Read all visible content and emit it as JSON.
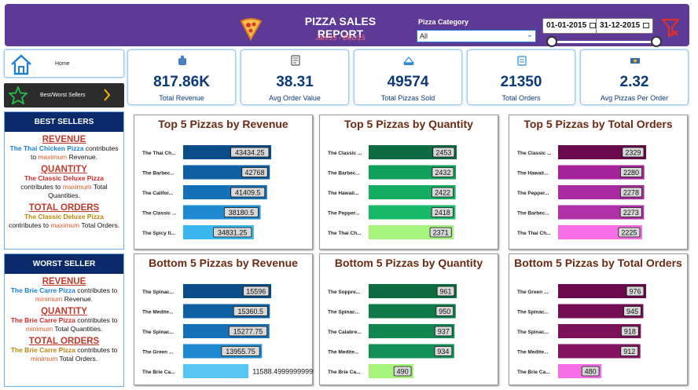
{
  "header": {
    "title": "PIZZA SALES REPORT",
    "subtitle": "Jan/15 - Dec/15",
    "category_label": "Pizza Category",
    "category_value": "All",
    "date_from": "01-01-2015",
    "date_to": "31-12-2015",
    "colors": {
      "bg": "#5d3a96",
      "subtitle": "#ff6b6b"
    }
  },
  "nav": {
    "home_label": "Home",
    "bw_label": "Best/Worst Sellers"
  },
  "best": {
    "heading": "BEST SELLERS",
    "revenue_title": "REVENUE",
    "revenue_pizza": "The Thai Chicken Pizza",
    "revenue_mid": " contributes to ",
    "revenue_kw": "maximum",
    "revenue_end": " Revenue.",
    "quantity_title": "QUANTITY",
    "quantity_pizza": "The Classic Deluxe Pizza",
    "quantity_mid": " contributes to ",
    "quantity_kw": "maximum",
    "quantity_end": " Total Quantities.",
    "orders_title": "TOTAL ORDERS",
    "orders_pizza": "The Classic Deluxe Pizza",
    "orders_mid": " contributes to ",
    "orders_kw": "maximum",
    "orders_end": " Total Orders."
  },
  "worst": {
    "heading": "WORST SELLER",
    "revenue_title": "REVENUE",
    "revenue_pizza": "The Brie Carre Pizza",
    "revenue_mid": " contributes to ",
    "revenue_kw": "minimum",
    "revenue_end": " Revenue.",
    "quantity_title": "QUANTITY",
    "quantity_pizza": "The Brie Carre Pizza",
    "quantity_mid": " contributes to ",
    "quantity_kw": "minimum",
    "quantity_end": " Total Quantities.",
    "orders_title": "TOTAL ORDERS",
    "orders_pizza": "The Brie Carre Pizza",
    "orders_mid": " contributes to ",
    "orders_kw": "minimum",
    "orders_end": " Total Orders."
  },
  "kpis": [
    {
      "value": "817.86K",
      "label": "Total Revenue",
      "icon": "money-bag-icon"
    },
    {
      "value": "38.31",
      "label": "Avg Order Value",
      "icon": "receipt-icon"
    },
    {
      "value": "49574",
      "label": "Total Pizzas Sold",
      "icon": "pizza-box-icon"
    },
    {
      "value": "21350",
      "label": "Total Orders",
      "icon": "clipboard-icon"
    },
    {
      "value": "2.32",
      "label": "Avg Pizzas Per Order",
      "icon": "cash-icon"
    }
  ],
  "chart_data": [
    {
      "type": "bar",
      "title": "Top 5 Pizzas by Revenue",
      "categories": [
        "The Thai Ch...",
        "The Barbec...",
        "The Califor...",
        "The Classic ...",
        "The Spicy It..."
      ],
      "values": [
        43434.25,
        42768,
        41409.5,
        38180.5,
        34831.25
      ],
      "value_labels": [
        "43434.25",
        "42768",
        "41409.5",
        "38180.5",
        "34831.25"
      ],
      "colors": [
        "#0b4d8a",
        "#0f5fa3",
        "#1570b8",
        "#1d8ad2",
        "#3ab6ee"
      ],
      "title_color": "#6b2b12"
    },
    {
      "type": "bar",
      "title": "Top 5 Pizzas by Quantity",
      "categories": [
        "The Classic ...",
        "The Barbec...",
        "The Hawaii...",
        "The Pepper...",
        "The Thai Ch..."
      ],
      "values": [
        2453,
        2432,
        2422,
        2418,
        2371
      ],
      "value_labels": [
        "2453",
        "2432",
        "2422",
        "2418",
        "2371"
      ],
      "colors": [
        "#0c6b3f",
        "#10a05a",
        "#14ad62",
        "#17b868",
        "#a6f57a"
      ],
      "title_color": "#6b2b12"
    },
    {
      "type": "bar",
      "title": "Top 5 Pizzas by Total Orders",
      "categories": [
        "The Classic ...",
        "The Hawaii...",
        "The Pepper...",
        "The Barbec...",
        "The Thai Ch..."
      ],
      "values": [
        2329,
        2280,
        2278,
        2273,
        2225
      ],
      "value_labels": [
        "2329",
        "2280",
        "2278",
        "2273",
        "2225"
      ],
      "colors": [
        "#6a0a4c",
        "#a4239a",
        "#aa2aa1",
        "#b030a8",
        "#f56fe6"
      ],
      "title_color": "#6b2b12"
    },
    {
      "type": "bar",
      "title": "Bottom 5 Pizzas by Revenue",
      "categories": [
        "The Spinac...",
        "The Medite...",
        "The Spinac...",
        "The Green ...",
        "The Brie Ca..."
      ],
      "values": [
        15596,
        15360.5,
        15277.75,
        13955.75,
        11588.5
      ],
      "value_labels": [
        "15596",
        "15360.5",
        "15277.75",
        "13955.75",
        "11588.499999999993"
      ],
      "colors": [
        "#0b4d8a",
        "#0f5fa3",
        "#1570b8",
        "#1d8ad2",
        "#57c6f2"
      ],
      "title_color": "#6b2b12"
    },
    {
      "type": "bar",
      "title": "Bottom 5 Pizzas by Quantity",
      "categories": [
        "The Soppre...",
        "The Spinac...",
        "The Calabre...",
        "The Medite...",
        "The Brie Ca..."
      ],
      "values": [
        961,
        950,
        937,
        934,
        490
      ],
      "value_labels": [
        "961",
        "950",
        "937",
        "934",
        "490"
      ],
      "colors": [
        "#0c6b3f",
        "#0f7a47",
        "#118650",
        "#139057",
        "#a6f57a"
      ],
      "title_color": "#6b2b12"
    },
    {
      "type": "bar",
      "title": "Bottom 5 Pizzas by Total Orders",
      "categories": [
        "The Green ...",
        "The Spinac...",
        "The Spinac...",
        "The Medite...",
        "The Brie Ca..."
      ],
      "values": [
        976,
        945,
        918,
        912,
        480
      ],
      "value_labels": [
        "976",
        "945",
        "918",
        "912",
        "480"
      ],
      "colors": [
        "#6a0a4c",
        "#730d53",
        "#7c115a",
        "#851460",
        "#f56fe6"
      ],
      "title_color": "#6b2b12"
    }
  ]
}
